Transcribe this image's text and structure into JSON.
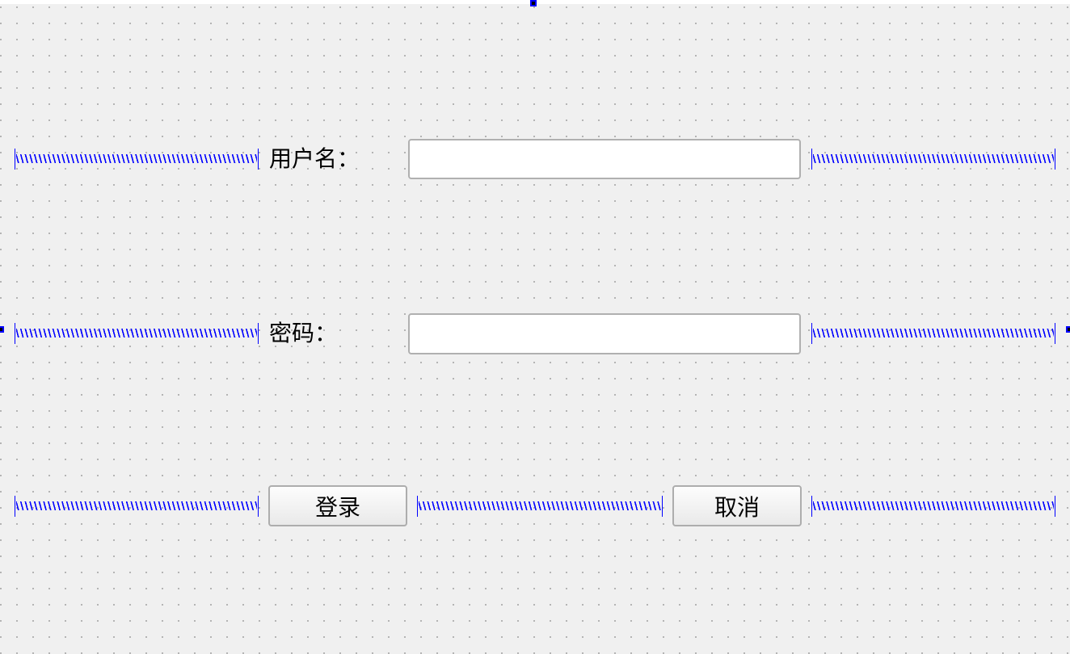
{
  "form": {
    "username_label": "用户名：",
    "username_value": "",
    "password_label": "密码：",
    "password_value": "",
    "login_button": "登录",
    "cancel_button": "取消"
  },
  "colors": {
    "spacer": "#0000ff",
    "background": "#f0f0f0"
  }
}
